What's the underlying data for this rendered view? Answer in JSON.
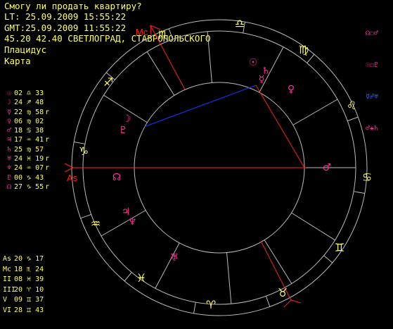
{
  "header": {
    "question": "Смогу ли продать квартиру?",
    "lt": "LT: 25.09.2009 15:55:22",
    "gmt": "GMT:25.09.2009 11:55:22",
    "place": "45.20 42.40 СВЕТЛОГРАД, СТАВРОПОЛЬСКОГО",
    "system": "Плацидус",
    "mode": "Карта"
  },
  "planets": [
    {
      "glyph": "☉",
      "text": "02 ♎ 33",
      "retro": "",
      "color": "#ff3399"
    },
    {
      "glyph": "☽",
      "text": "24 ♐ 48",
      "retro": "",
      "color": "#ff3399"
    },
    {
      "glyph": "☿",
      "text": "22 ♍ 58",
      "retro": "r",
      "color": "#ff3399"
    },
    {
      "glyph": "♀",
      "text": "06 ♍ 02",
      "retro": "",
      "color": "#ff3399"
    },
    {
      "glyph": "♂",
      "text": "18 ♋ 38",
      "retro": "",
      "color": "#ff3399"
    },
    {
      "glyph": "♃",
      "text": "17 ♒ 41",
      "retro": "r",
      "color": "#ff3399"
    },
    {
      "glyph": "♄",
      "text": "25 ♍ 57",
      "retro": "",
      "color": "#ff3399"
    },
    {
      "glyph": "♅",
      "text": "24 ♓ 19",
      "retro": "r",
      "color": "#ff3399"
    },
    {
      "glyph": "♆",
      "text": "24 ♒ 07",
      "retro": "r",
      "color": "#ff3399"
    },
    {
      "glyph": "♇",
      "text": "00 ♑ 43",
      "retro": "",
      "color": "#ff3399"
    },
    {
      "glyph": "☊",
      "text": "27 ♑ 55",
      "retro": "r",
      "color": "#ff3399"
    }
  ],
  "cusps": [
    {
      "label": "As",
      "text": "20 ♑ 17"
    },
    {
      "label": "Mc",
      "text": "18 ♏ 24"
    },
    {
      "label": "II",
      "text": "08 ♓ 39"
    },
    {
      "label": "III",
      "text": "20 ♈ 10"
    },
    {
      "label": "V",
      "text": "09 ♊ 37"
    },
    {
      "label": "VI",
      "text": "28 ♊ 43"
    }
  ],
  "legend": [
    {
      "text": "☊☐♂",
      "color": "#ff3399"
    },
    {
      "text": "☉☐♇",
      "color": "#ff3399"
    },
    {
      "text": "☿☍♅",
      "color": "#3366ff"
    },
    {
      "text": "♂⚹♄",
      "color": "#ff3399"
    }
  ],
  "angles": {
    "as": "As",
    "mc": "Mc"
  },
  "chart_signs": [
    {
      "name": "libra",
      "glyph": "♎"
    },
    {
      "name": "virgo",
      "glyph": "♍"
    },
    {
      "name": "leo",
      "glyph": "♌"
    },
    {
      "name": "cancer",
      "glyph": "♋"
    },
    {
      "name": "gemini",
      "glyph": "♊"
    },
    {
      "name": "taurus",
      "glyph": "♉"
    },
    {
      "name": "aries",
      "glyph": "♈"
    },
    {
      "name": "pisces",
      "glyph": "♓"
    },
    {
      "name": "aquarius",
      "glyph": "♒"
    },
    {
      "name": "capricorn",
      "glyph": "♑"
    },
    {
      "name": "sagittarius",
      "glyph": "♐"
    },
    {
      "name": "scorpio",
      "glyph": "♏"
    }
  ],
  "chart_planets": [
    {
      "name": "sun",
      "glyph": "☉"
    },
    {
      "name": "saturn",
      "glyph": "♄"
    },
    {
      "name": "mercury",
      "glyph": "☿"
    },
    {
      "name": "venus",
      "glyph": "♀"
    },
    {
      "name": "mars",
      "glyph": "♂"
    },
    {
      "name": "moon",
      "glyph": "☽"
    },
    {
      "name": "pluto",
      "glyph": "♇"
    },
    {
      "name": "node",
      "glyph": "☊"
    },
    {
      "name": "jupiter",
      "glyph": "♃"
    },
    {
      "name": "neptune",
      "glyph": "♆"
    },
    {
      "name": "uranus",
      "glyph": "♅"
    }
  ],
  "colors": {
    "text": "#ffff66",
    "planet": "#ff3399",
    "aspect_red": "#ff2222",
    "aspect_blue": "#2233ff",
    "ring": "#bbbbbb"
  }
}
